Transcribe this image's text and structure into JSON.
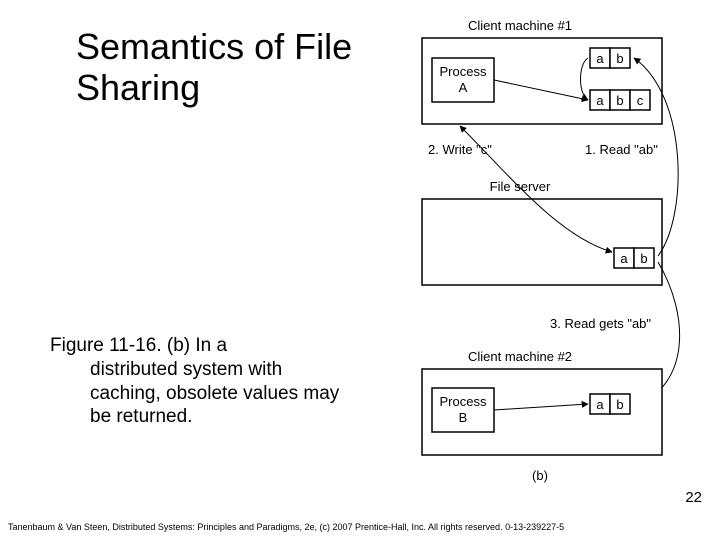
{
  "title": "Semantics of File Sharing",
  "caption_lead": "Figure 11-16. (b) In a",
  "caption_body": "distributed system with caching, obsolete values may be returned.",
  "page_number": "22",
  "footer": "Tanenbaum & Van Steen, Distributed Systems: Principles and Paradigms, 2e, (c) 2007 Prentice-Hall, Inc. All rights reserved. 0-13-239227-5",
  "fig": {
    "client1": "Client machine #1",
    "client2": "Client machine #2",
    "fileserver": "File server",
    "procA1": "Process",
    "procA2": "A",
    "procB1": "Process",
    "procB2": "B",
    "step1": "1. Read \"ab\"",
    "step2": "2. Write \"c\"",
    "step3": "3. Read gets \"ab\"",
    "a": "a",
    "b": "b",
    "c": "c",
    "label_b": "(b)"
  }
}
